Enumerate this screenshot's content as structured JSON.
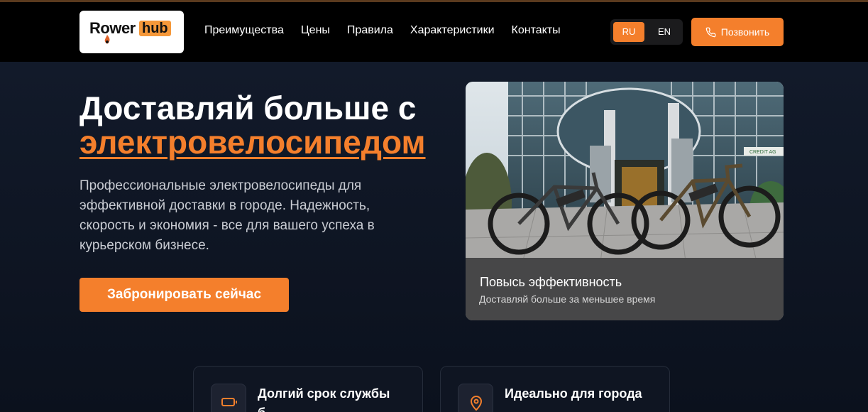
{
  "brand": {
    "logo_part1": "Rower",
    "logo_part2": "hub",
    "accent": "#f47f2c"
  },
  "nav": {
    "links": [
      "Преимущества",
      "Цены",
      "Правила",
      "Характеристики",
      "Контакты"
    ],
    "lang_ru": "RU",
    "lang_en": "EN",
    "active_lang": "RU",
    "call_label": "Позвонить",
    "call_icon": "phone-icon"
  },
  "hero": {
    "title_line1": "Доставляй больше с",
    "title_accent": "электровелосипедом",
    "description": "Профессиональные электровелосипеды для эффективной доставки в городе. Надежность, скорость и экономия - все для вашего успеха в курьерском бизнесе.",
    "cta_label": "Забронировать сейчас"
  },
  "photo": {
    "caption_title": "Повысь эффективность",
    "caption_sub": "Доставляй больше за меньшее время",
    "sign_text": "CREDIT AG"
  },
  "features": [
    {
      "title": "Долгий срок службы",
      "subtitle": "б",
      "icon": "battery-icon"
    },
    {
      "title": "Идеально для города",
      "subtitle": "–",
      "icon": "map-pin-icon"
    }
  ]
}
